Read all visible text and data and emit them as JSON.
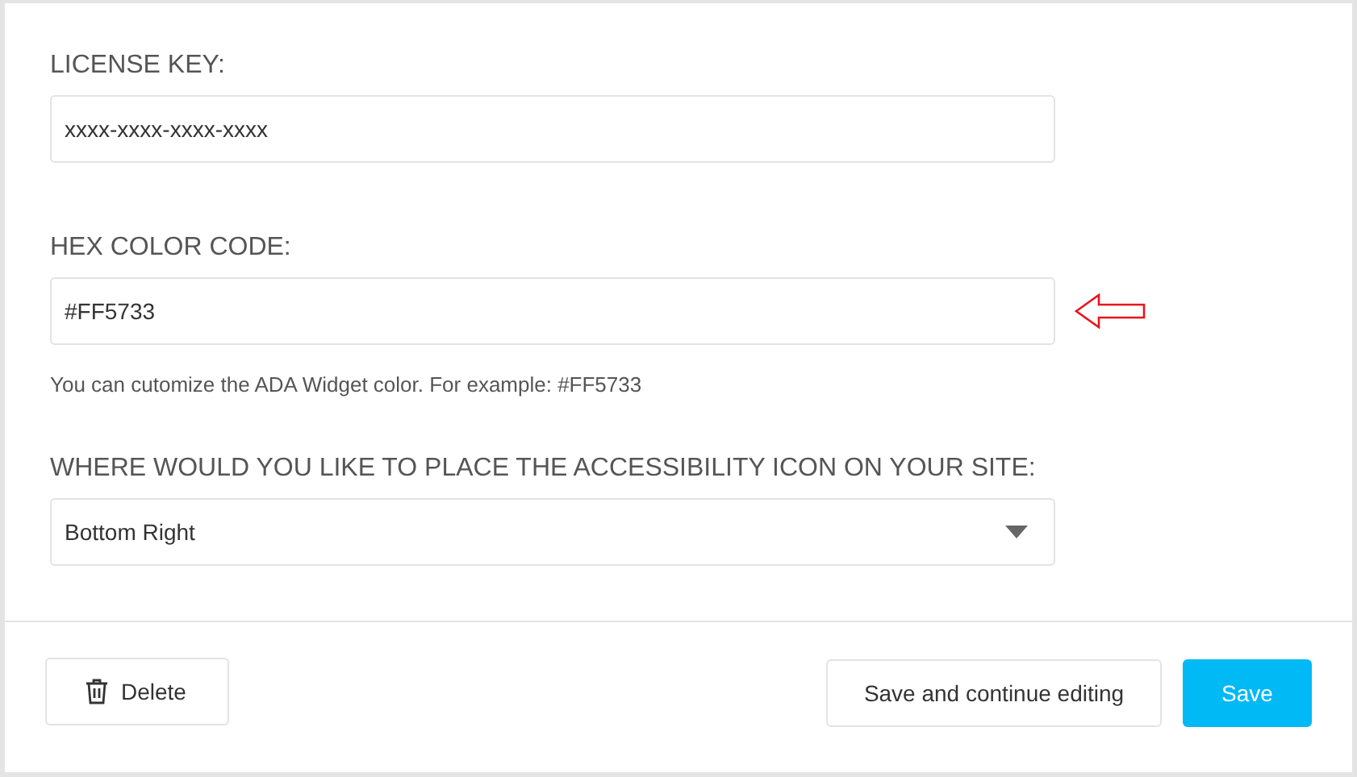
{
  "fields": [
    {
      "kind": "text",
      "label": "LICENSE KEY:",
      "value": "xxxx-xxxx-xxxx-xxxx",
      "annotated": false
    },
    {
      "kind": "text",
      "label": "HEX COLOR CODE:",
      "value": "#FF5733",
      "annotated": true,
      "help": "You can cutomize the ADA Widget color. For example: #FF5733"
    },
    {
      "kind": "select",
      "label": "WHERE WOULD YOU LIKE TO PLACE THE ACCESSIBILITY ICON ON YOUR SITE:",
      "value": "Bottom Right",
      "annotated": false
    }
  ],
  "buttons": [
    {
      "kind": "delete",
      "label": "Delete"
    },
    {
      "kind": "secondary",
      "label": "Save and continue editing"
    },
    {
      "kind": "primary",
      "label": "Save"
    }
  ]
}
